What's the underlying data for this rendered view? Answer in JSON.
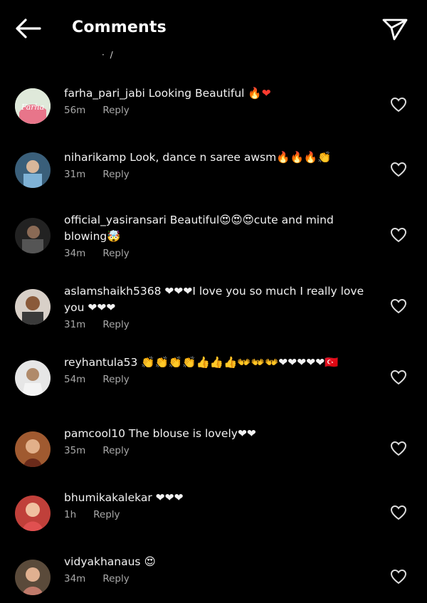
{
  "header": {
    "title": "Comments"
  },
  "comments": [
    {
      "user": "farha_pari_jabi",
      "text": "Looking Beautiful",
      "emojis": "🔥❤",
      "time": "56m",
      "reply": "Reply"
    },
    {
      "user": "niharikamp",
      "text": "Look,  dance n saree awsm",
      "emojis": "🔥🔥🔥👏",
      "time": "31m",
      "reply": "Reply"
    },
    {
      "user": "official_yasiransari",
      "text": "Beautiful😍😍😍cute and mind blowing🤯",
      "emojis": "",
      "time": "34m",
      "reply": "Reply"
    },
    {
      "user": "aslamshaikh5368",
      "text": "❤❤❤I love you so much I really love you ❤❤❤",
      "emojis": "",
      "time": "31m",
      "reply": "Reply"
    },
    {
      "user": "reyhantula53",
      "text": "👏👏👏👏👍👍👍👐👐👐❤❤❤❤❤🇹🇷",
      "emojis": "",
      "time": "54m",
      "reply": "Reply"
    },
    {
      "user": "pamcool10",
      "text": "The blouse is lovely❤❤",
      "emojis": "",
      "time": "35m",
      "reply": "Reply"
    },
    {
      "user": "bhumikakalekar",
      "text": "❤❤❤",
      "emojis": "",
      "time": "1h",
      "reply": "Reply"
    },
    {
      "user": "vidyakhanaus",
      "text": "😍",
      "emojis": "",
      "time": "34m",
      "reply": "Reply"
    }
  ],
  "avatars": [
    {
      "label": "Farha",
      "colors": [
        "#e8f0e0",
        "#e06a7a"
      ]
    },
    {
      "label": "",
      "colors": [
        "#3a6a8a",
        "#8ab"
      ]
    },
    {
      "label": "",
      "colors": [
        "#2b2b2b",
        "#6a6a6a"
      ]
    },
    {
      "label": "",
      "colors": [
        "#7a5a3a",
        "#c7b19a"
      ]
    },
    {
      "label": "",
      "colors": [
        "#d9d9d9",
        "#b08a6a"
      ]
    },
    {
      "label": "",
      "colors": [
        "#8a4a2a",
        "#d7a070"
      ]
    },
    {
      "label": "",
      "colors": [
        "#b03a3a",
        "#e8b090"
      ]
    },
    {
      "label": "",
      "colors": [
        "#7a6a5a",
        "#d0a890"
      ]
    }
  ]
}
